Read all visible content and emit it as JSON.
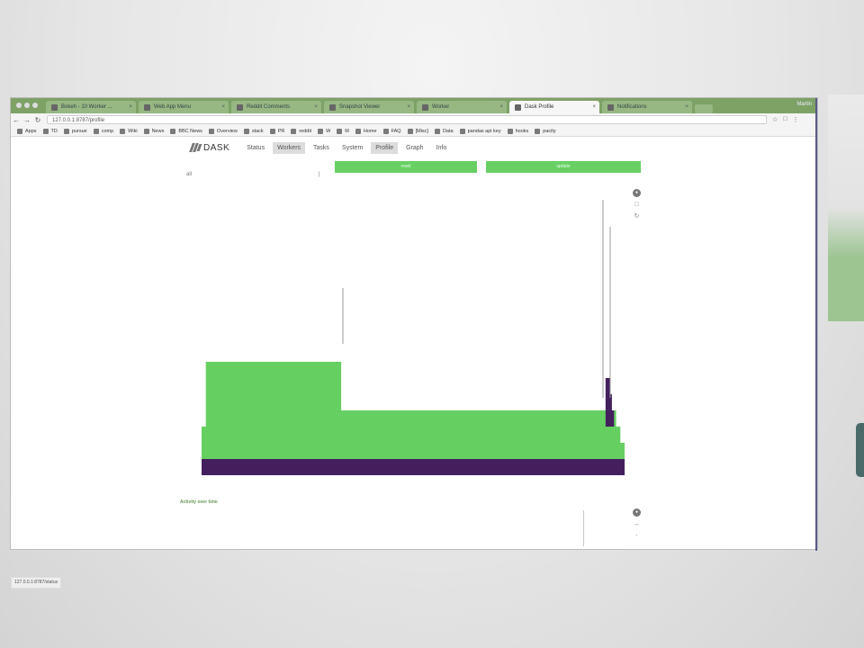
{
  "browser": {
    "tabs": [
      {
        "label": "Bokeh - 10 Worker ...",
        "active": false
      },
      {
        "label": "Web App Menu",
        "active": false
      },
      {
        "label": "Reddit Comments",
        "active": false
      },
      {
        "label": "Snapshot Viewer",
        "active": false
      },
      {
        "label": "Worker",
        "active": false
      },
      {
        "label": "Dask Profile",
        "active": true
      },
      {
        "label": "Notifications",
        "active": false
      }
    ],
    "user": "Martin",
    "address": "127.0.0.1:8787/profile",
    "bookmarks": [
      "Apps",
      "TD",
      "pursue",
      "comp",
      "Wiki",
      "News",
      "BBC News",
      "Overview",
      "stack",
      "PR",
      "reddit",
      "W",
      "M",
      "Home",
      "FAQ",
      "[Misc]",
      "Data",
      "pandas api key",
      "hooks",
      "pacity"
    ]
  },
  "nav": {
    "brand": "DASK",
    "items": [
      "Status",
      "Workers",
      "Tasks",
      "System",
      "Profile",
      "Graph",
      "Info"
    ],
    "highlighted": [
      "Workers",
      "Profile"
    ]
  },
  "controls": {
    "reset_label": "reset",
    "update_label": "update",
    "left_small": "all",
    "mid_small": "|"
  },
  "tools": {
    "top": [
      "pan-icon",
      "box-zoom-icon",
      "reset-icon"
    ],
    "bottom": [
      "pan-icon",
      "reset-icon",
      "save-icon"
    ]
  },
  "timeline": {
    "title": "Activity over time"
  },
  "status_url": "127.0.0.1:8787/status",
  "colors": {
    "green": "#66cf62",
    "purple": "#441f5e",
    "tab_green": "#7ea266"
  },
  "chart_data": {
    "type": "area",
    "title": "",
    "xlabel": "",
    "ylabel": "",
    "note": "Profile flame chart: stacked depths, widths relative to total samples (0-1)",
    "series": [
      {
        "name": "",
        "color": "#441f5e",
        "rects": [
          {
            "x0": 0.0,
            "x1": 1.0,
            "depth": 0
          }
        ]
      },
      {
        "name": "",
        "color": "#66cf62",
        "rects": [
          {
            "x0": 0.0,
            "x1": 1.0,
            "depth": 1
          },
          {
            "x0": 0.0,
            "x1": 0.99,
            "depth": 2
          },
          {
            "x0": 0.01,
            "x1": 0.98,
            "depth": 3
          },
          {
            "x0": 0.01,
            "x1": 0.33,
            "depth": 4
          },
          {
            "x0": 0.01,
            "x1": 0.33,
            "depth": 5
          },
          {
            "x0": 0.01,
            "x1": 0.2,
            "depth": 6
          },
          {
            "x0": 0.2,
            "x1": 0.33,
            "depth": 6
          }
        ]
      },
      {
        "name": "",
        "color": "#441f5e",
        "rects": [
          {
            "x0": 0.955,
            "x1": 0.975,
            "depth": 3
          },
          {
            "x0": 0.955,
            "x1": 0.97,
            "depth": 4
          },
          {
            "x0": 0.955,
            "x1": 0.965,
            "depth": 5
          }
        ]
      }
    ],
    "depth_max": 7
  }
}
